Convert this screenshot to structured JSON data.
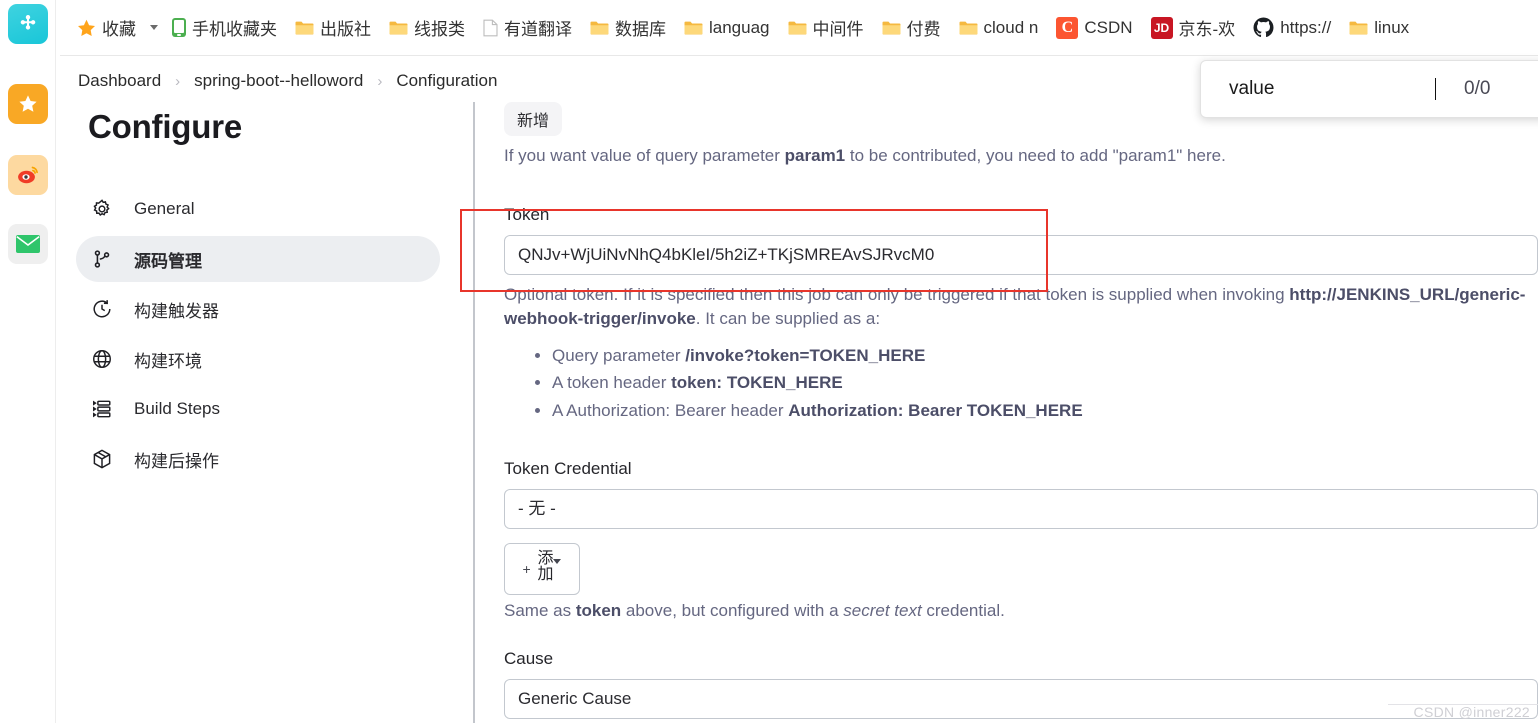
{
  "browser": {
    "bookmarks": [
      {
        "icon": "star-icon",
        "label": "收藏",
        "has_caret": true
      },
      {
        "icon": "phone-icon",
        "label": "手机收藏夹",
        "has_caret": false
      },
      {
        "icon": "folder-icon",
        "label": "出版社",
        "has_caret": false
      },
      {
        "icon": "folder-icon",
        "label": "线报类",
        "has_caret": false
      },
      {
        "icon": "document-icon",
        "label": "有道翻译",
        "has_caret": false
      },
      {
        "icon": "folder-icon",
        "label": "数据库",
        "has_caret": false
      },
      {
        "icon": "folder-icon",
        "label": "languag",
        "has_caret": false
      },
      {
        "icon": "folder-icon",
        "label": "中间件",
        "has_caret": false
      },
      {
        "icon": "folder-icon",
        "label": "付费",
        "has_caret": false
      },
      {
        "icon": "folder-icon",
        "label": "cloud n",
        "has_caret": false
      },
      {
        "icon": "csdn-icon",
        "label": "CSDN",
        "has_caret": false
      },
      {
        "icon": "jd-icon",
        "label": "京东-欢",
        "has_caret": false
      },
      {
        "icon": "github-icon",
        "label": "https://",
        "has_caret": false
      },
      {
        "icon": "folder-icon",
        "label": "linux",
        "has_caret": false
      }
    ],
    "rail_icons": [
      "app-logo-icon",
      "favorites-star-icon",
      "weibo-icon",
      "mail-icon"
    ]
  },
  "find_bar": {
    "query": "value",
    "placeholder": "",
    "match_count": "0/0"
  },
  "breadcrumb": {
    "items": [
      "Dashboard",
      "spring-boot--helloword",
      "Configuration"
    ],
    "separator": "›"
  },
  "configure": {
    "title": "Configure",
    "items": [
      {
        "icon": "gear-icon",
        "label": "General",
        "active": false
      },
      {
        "icon": "git-branch-icon",
        "label": "源码管理",
        "active": true
      },
      {
        "icon": "clock-icon",
        "label": "构建触发器",
        "active": false
      },
      {
        "icon": "globe-icon",
        "label": "构建环境",
        "active": false
      },
      {
        "icon": "list-steps-icon",
        "label": "Build Steps",
        "active": false
      },
      {
        "icon": "package-icon",
        "label": "构建后操作",
        "active": false
      }
    ]
  },
  "form": {
    "add_chip_label": "新增",
    "param_help_prefix": "If you want value of query parameter ",
    "param_help_bold": "param1",
    "param_help_suffix": " to be contributed, you need to add \"param1\" here.",
    "token_label": "Token",
    "token_value": "QNJv+WjUiNvNhQ4bKleI/5h2iZ+TKjSMREAvSJRvcM0",
    "token_desc_1": "Optional token. If it is specified then this job can only be triggered if that token is supplied when invoking ",
    "token_desc_url_1": "http://JENKINS_URL/generic-webhook-trigger/invoke",
    "token_desc_2": ". It can be supplied as a:",
    "token_bullets": [
      {
        "text": "Query parameter ",
        "bold": "/invoke?token=TOKEN_HERE"
      },
      {
        "text": "A token header ",
        "bold": "token: TOKEN_HERE"
      },
      {
        "text": "A Authorization: Bearer header ",
        "bold": "Authorization: Bearer TOKEN_HERE"
      }
    ],
    "credential_label": "Token Credential",
    "credential_value": "- 无 -",
    "add_button_label": "添加",
    "add_button_plus": "+",
    "credential_desc_1": "Same as ",
    "credential_desc_bold": "token",
    "credential_desc_2": " above, but configured with a ",
    "credential_desc_italic": "secret text",
    "credential_desc_3": " credential.",
    "cause_label": "Cause",
    "cause_value": "Generic Cause"
  },
  "watermark": "CSDN @inner222",
  "colors": {
    "accent_red": "#e8352b",
    "active_bg": "#eceef1",
    "help_text": "#656781",
    "folder": "#f5b940"
  }
}
